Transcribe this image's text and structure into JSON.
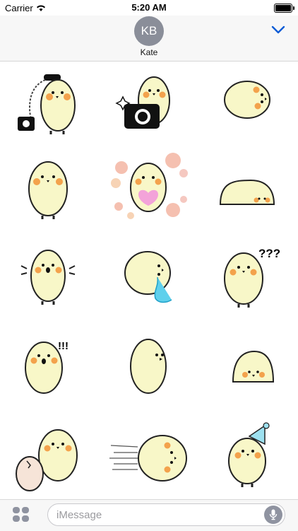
{
  "status_bar": {
    "carrier": "Carrier",
    "time": "5:20 AM"
  },
  "header": {
    "avatar_initials": "KB",
    "contact_name": "Kate",
    "accent_color": "#0a5bd6"
  },
  "stickers": [
    {
      "name": "chick-with-telephone"
    },
    {
      "name": "chick-with-camera"
    },
    {
      "name": "chick-lying-down"
    },
    {
      "name": "chick-standing"
    },
    {
      "name": "chick-with-heart-bubbles"
    },
    {
      "name": "chick-flat-resting"
    },
    {
      "name": "chick-arms-out"
    },
    {
      "name": "chick-crying"
    },
    {
      "name": "chick-confused",
      "caption": "???"
    },
    {
      "name": "chick-surprised",
      "caption": "!!!"
    },
    {
      "name": "chick-side-view"
    },
    {
      "name": "chick-small-blob"
    },
    {
      "name": "chick-with-egg"
    },
    {
      "name": "chick-dashing"
    },
    {
      "name": "chick-party-hat"
    }
  ],
  "input": {
    "placeholder": "iMessage"
  },
  "icons": {
    "wifi": "wifi-icon",
    "battery": "battery-icon",
    "chevron": "chevron-down-icon",
    "apps": "apps-icon",
    "mic": "microphone-icon"
  },
  "colors": {
    "chick_body": "#f8f7c8",
    "cheek": "#f3a24c",
    "mic": "#8f93a0"
  }
}
